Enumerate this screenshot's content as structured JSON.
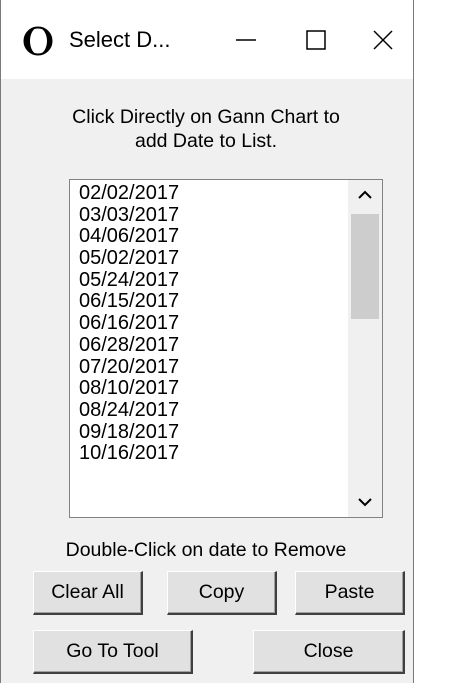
{
  "window": {
    "title": "Select D...",
    "icon": "moon-phase-icon"
  },
  "titlebar_buttons": {
    "minimize": "—",
    "maximize": "☐",
    "close": "✕"
  },
  "instruction": {
    "line1": "Click Directly on Gann Chart to",
    "line2": "add Date to List."
  },
  "dates_list": [
    "02/02/2017",
    "03/03/2017",
    "04/06/2017",
    "05/02/2017",
    "05/24/2017",
    "06/15/2017",
    "06/16/2017",
    "06/28/2017",
    "07/20/2017",
    "08/10/2017",
    "08/24/2017",
    "09/18/2017",
    "10/16/2017"
  ],
  "remove_hint": "Double-Click on date to Remove",
  "buttons": {
    "clear_all": "Clear All",
    "copy": "Copy",
    "paste": "Paste",
    "go_to_tool": "Go To Tool",
    "close": "Close"
  }
}
